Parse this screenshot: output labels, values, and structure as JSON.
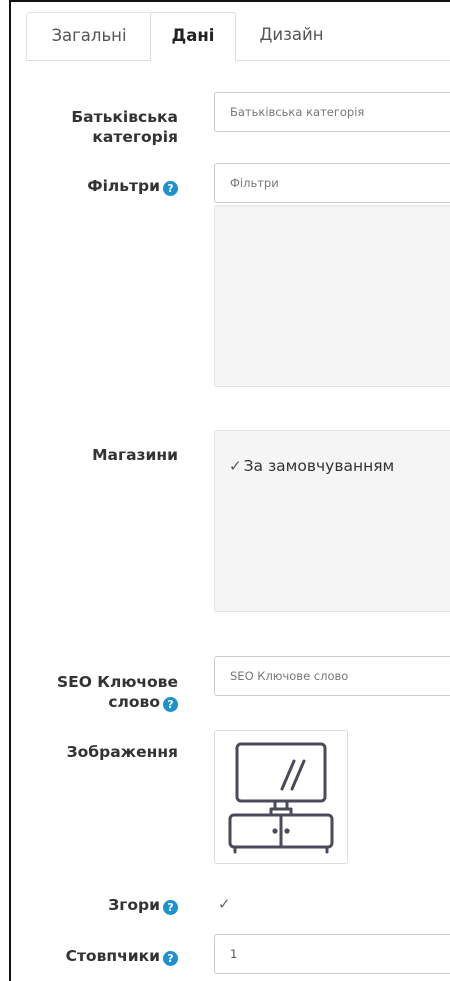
{
  "tabs": [
    {
      "label": "Загальні"
    },
    {
      "label": "Дані"
    },
    {
      "label": "Дизайн"
    }
  ],
  "fields": {
    "parent_category": {
      "label": "Батьківська категорія",
      "label_line1": "Батьківська",
      "label_line2": "категорія",
      "placeholder": "Батьківська категорія"
    },
    "filters": {
      "label": "Фільтри",
      "placeholder": "Фільтри"
    },
    "stores": {
      "label": "Магазини",
      "options": [
        {
          "label": "За замовчуванням",
          "checked": true
        }
      ]
    },
    "seo_keyword": {
      "label": "SEO Ключове слово",
      "label_line1": "SEO Ключове",
      "label_line2": "слово",
      "placeholder": "SEO Ключове слово"
    },
    "image": {
      "label": "Зображення",
      "icon": "tv-stand-icon"
    },
    "top": {
      "label": "Згори",
      "checked": true
    },
    "columns": {
      "label": "Стовпчики",
      "value": "1"
    }
  },
  "help_icon": "?",
  "check_glyph": "✓",
  "colors": {
    "help_icon": "#1e91cf",
    "well_bg": "#f5f5f5"
  }
}
